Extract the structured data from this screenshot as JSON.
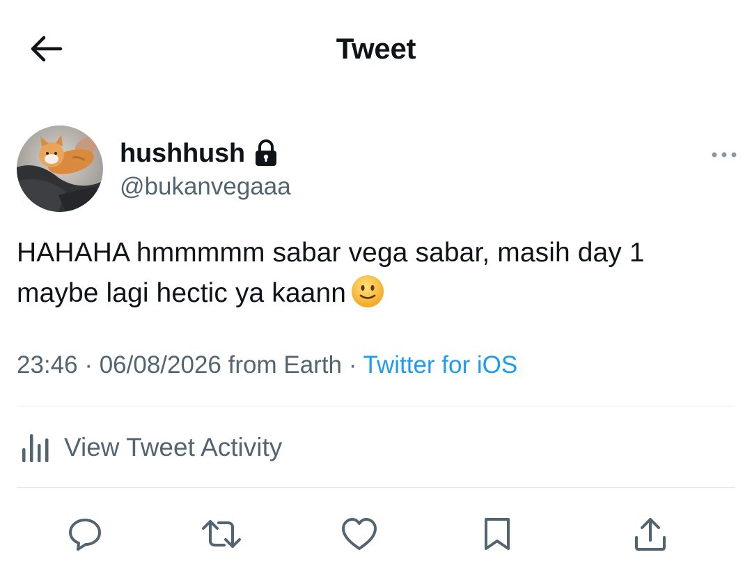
{
  "header": {
    "title": "Tweet",
    "back_icon": "arrow-left-icon"
  },
  "author": {
    "display_name": "hushhush",
    "handle": "@bukanvegaaa",
    "protected_icon": "lock-icon",
    "avatar_description_icon": "kitten-photo"
  },
  "tweet": {
    "text_line_1": "HAHAHA hmmmmm sabar vega sabar, masih day 1",
    "text_line_2": "maybe lagi hectic ya kaann",
    "emoji": "slightly-smiling-face"
  },
  "meta": {
    "time": "23:46",
    "separator": "·",
    "date": "06/08/2026",
    "location": "from Earth",
    "source": "Twitter for iOS"
  },
  "activity": {
    "label": "View Tweet Activity",
    "icon": "bar-chart-icon"
  },
  "actions": [
    "reply-icon",
    "retweet-icon",
    "like-icon",
    "bookmark-icon",
    "share-icon"
  ],
  "colors": {
    "text": "#0f1419",
    "secondary": "#536471",
    "link": "#1d9bf0",
    "divider": "#dfe5e8"
  }
}
